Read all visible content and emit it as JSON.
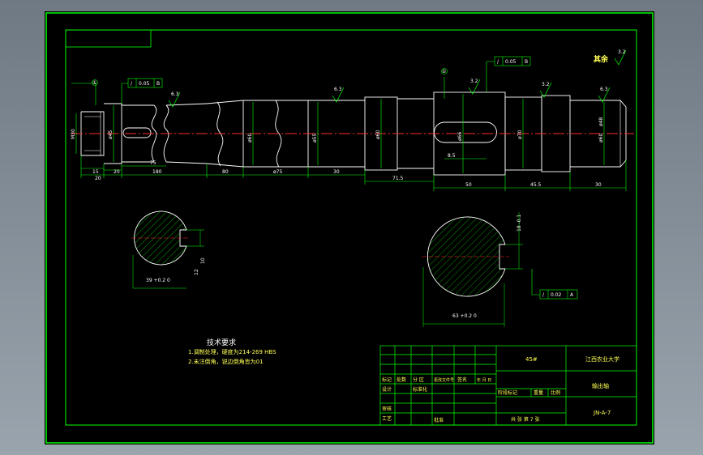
{
  "dimensions": {
    "horizontal": [
      "20",
      "15",
      "20",
      "75",
      "180",
      "80",
      "ø75",
      "30",
      "71.5",
      "50",
      "45.5",
      "30"
    ],
    "diameters": [
      "M30",
      "ø45",
      "ø60",
      "ø55",
      "ø60",
      "ø66",
      "ø70",
      "ø60",
      "ø48"
    ],
    "keyway_dims": [
      "8.5"
    ]
  },
  "roughness": [
    "6.3",
    "6.3",
    "3.2",
    "3.2",
    "6.3"
  ],
  "roughness_default": "3.2",
  "roughness_default_label": "其余",
  "tolerance_frames": [
    {
      "sym": "/",
      "value": "0.05",
      "datum": "B"
    },
    {
      "sym": "/",
      "value": "0.05",
      "datum": "B"
    },
    {
      "sym": "/",
      "value": "0.02",
      "datum": "A"
    }
  ],
  "datum_circles": [
    "①",
    "①"
  ],
  "sections": {
    "left": {
      "dims": [
        "39 +0.2 0",
        "10",
        "12"
      ]
    },
    "right": {
      "dims": [
        "63 +0.2 0",
        "18 -0.1"
      ]
    }
  },
  "tech_req": {
    "title": "技术要求",
    "lines": [
      "1.调制处理，硬度为214-269 HBS",
      "2.未注倒角，锐边倒角皆为01"
    ]
  },
  "title_block": {
    "material": "45#",
    "school": "江西农业大学",
    "part_name": "输出轴",
    "drawing_no": "JN-A-7",
    "sheet": "共 张 第 7 张",
    "headers": [
      "标记",
      "处数",
      "分 区",
      "更改文件号",
      "签名",
      "年 月 日"
    ],
    "roles": [
      "设计",
      "审核",
      "工艺"
    ],
    "row_labels": [
      "标准化",
      "阶段标记",
      "重量",
      "比例",
      "批准"
    ]
  }
}
